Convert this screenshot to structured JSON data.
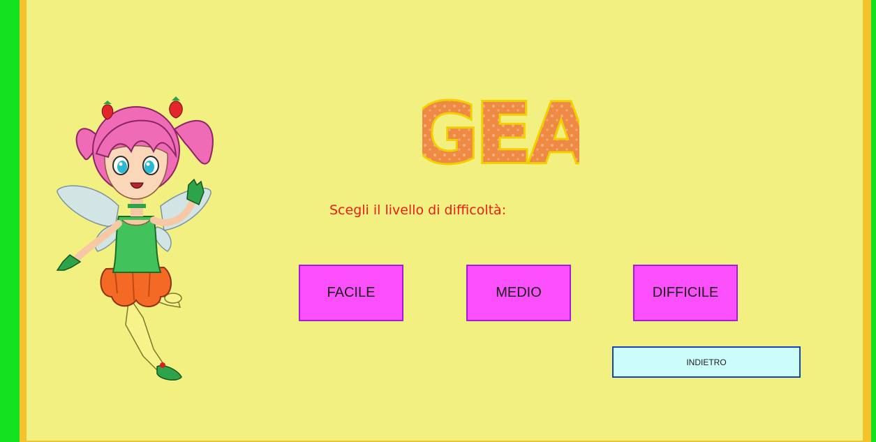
{
  "colors": {
    "outer_background": "#13e01f",
    "frame_border": "#f3c22c",
    "panel_background": "#f3f082",
    "prompt_text": "#e81f17",
    "level_button_fill": "#fb4ffb",
    "level_button_border": "#a41cd9",
    "back_button_fill": "#cdfdfb",
    "back_button_border": "#1343c4",
    "logo_fill": "#ef8a45",
    "logo_outline": "#f2d000"
  },
  "logo": {
    "text": "GEA"
  },
  "mascot": {
    "icon": "fairy-character-illustration"
  },
  "prompt": {
    "text": "Scegli il livello di difficoltà:"
  },
  "levels": {
    "facile": "FACILE",
    "medio": "MEDIO",
    "difficile": "DIFFICILE"
  },
  "navigation": {
    "back_label": "INDIETRO"
  }
}
